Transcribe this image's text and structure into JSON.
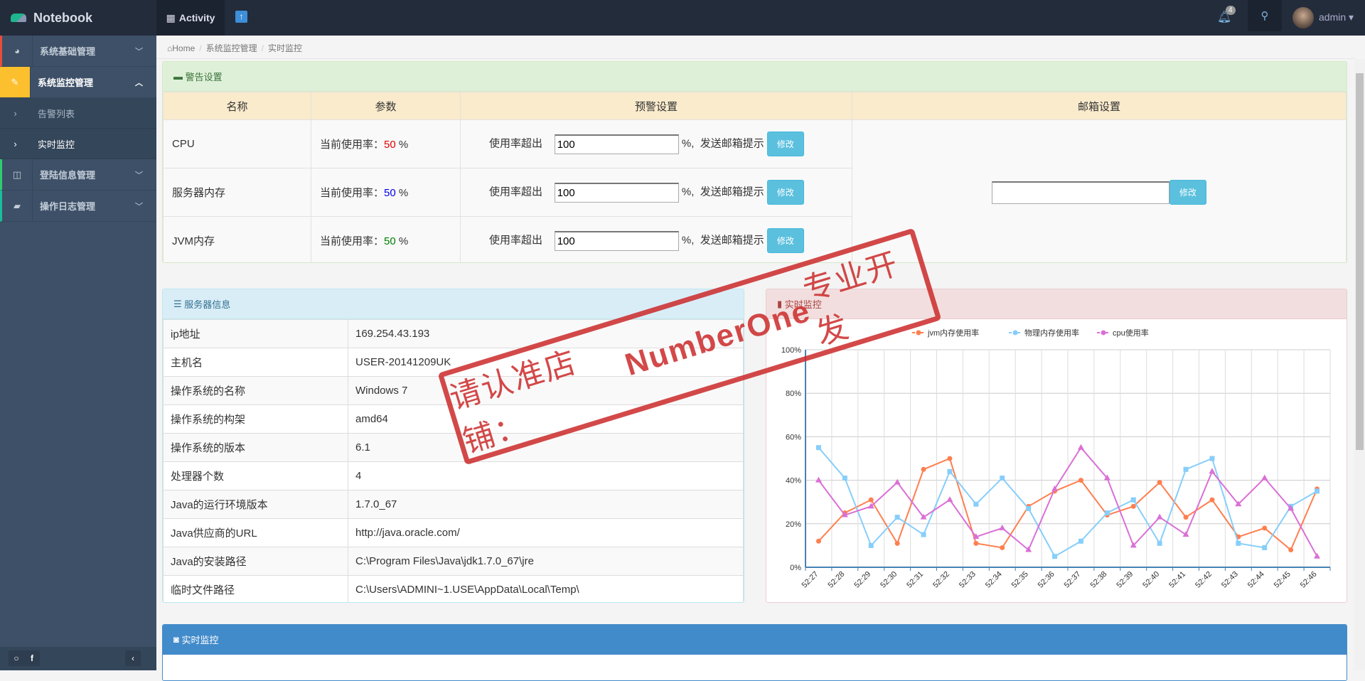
{
  "header": {
    "brand": "Notebook",
    "activity": "Activity",
    "notifications": "4",
    "user": "admin"
  },
  "sidebar": {
    "items": [
      {
        "label": "系统基础管理",
        "icon": "dashboard-icon"
      },
      {
        "label": "系统监控管理",
        "icon": "edit-icon",
        "sub": [
          {
            "label": "告警列表"
          },
          {
            "label": "实时监控"
          }
        ]
      },
      {
        "label": "登陆信息管理",
        "icon": "columns-icon"
      },
      {
        "label": "操作日志管理",
        "icon": "book-icon"
      }
    ]
  },
  "breadcrumb": [
    "Home",
    "系统监控管理",
    "实时监控"
  ],
  "alert": {
    "title": "警告设置",
    "headers": [
      "名称",
      "参数",
      "预警设置",
      "邮箱设置"
    ],
    "rows": [
      {
        "name": "CPU",
        "param_label": "当前使用率：",
        "value": "50",
        "unit": "%",
        "color": "#e00000",
        "threshold_label": "使用率超出",
        "threshold": "100",
        "suffix": "%,  发送邮箱提示",
        "btn": "修改"
      },
      {
        "name": "服务器内存",
        "param_label": "当前使用率：",
        "value": "50",
        "unit": "%",
        "color": "#0000ee",
        "threshold_label": "使用率超出",
        "threshold": "100",
        "suffix": "%,  发送邮箱提示",
        "btn": "修改"
      },
      {
        "name": "JVM内存",
        "param_label": "当前使用率：",
        "value": "50",
        "unit": "%",
        "color": "#008000",
        "threshold_label": "使用率超出",
        "threshold": "100",
        "suffix": "%,  发送邮箱提示",
        "btn": "修改"
      }
    ],
    "email": {
      "value": "",
      "btn": "修改"
    }
  },
  "server": {
    "title": "服务器信息",
    "rows": [
      [
        "ip地址",
        "169.254.43.193"
      ],
      [
        "主机名",
        "USER-20141209UK"
      ],
      [
        "操作系统的名称",
        "Windows 7"
      ],
      [
        "操作系统的构架",
        "amd64"
      ],
      [
        "操作系统的版本",
        "6.1"
      ],
      [
        "处理器个数",
        "4"
      ],
      [
        "Java的运行环境版本",
        "1.7.0_67"
      ],
      [
        "Java供应商的URL",
        "http://java.oracle.com/"
      ],
      [
        "Java的安装路径",
        "C:\\Program Files\\Java\\jdk1.7.0_67\\jre"
      ],
      [
        "临时文件路径",
        "C:\\Users\\ADMINI~1.USE\\AppData\\Local\\Temp\\"
      ]
    ]
  },
  "monitor": {
    "title": "实时监控"
  },
  "bottom": {
    "title": "实时监控"
  },
  "stamp": "请认准店铺：NumberOne专业开发",
  "chart_data": {
    "type": "line",
    "title": "",
    "xlabel": "",
    "ylabel": "",
    "ylim": [
      0,
      100
    ],
    "yticks": [
      "0%",
      "20%",
      "40%",
      "60%",
      "80%",
      "100%"
    ],
    "categories": [
      "52:27",
      "52:28",
      "52:29",
      "52:30",
      "52:31",
      "52:32",
      "52:33",
      "52:34",
      "52:35",
      "52:36",
      "52:37",
      "52:38",
      "52:39",
      "52:40",
      "52:41",
      "52:42",
      "52:43",
      "52:44",
      "52:45",
      "52:46"
    ],
    "legend_position": "top-center",
    "series": [
      {
        "name": "jvm内存使用率",
        "color": "#ff7f50",
        "marker": "circle",
        "values": [
          12,
          25,
          31,
          11,
          45,
          50,
          11,
          9,
          28,
          35,
          40,
          24,
          28,
          39,
          23,
          31,
          14,
          18,
          8,
          36
        ]
      },
      {
        "name": "物理内存使用率",
        "color": "#87cefa",
        "marker": "square",
        "values": [
          55,
          41,
          10,
          23,
          15,
          44,
          29,
          41,
          27,
          5,
          12,
          25,
          31,
          11,
          45,
          50,
          11,
          9,
          28,
          35
        ]
      },
      {
        "name": "cpu使用率",
        "color": "#da70d6",
        "marker": "triangle",
        "values": [
          40,
          24,
          28,
          39,
          23,
          31,
          14,
          18,
          8,
          36,
          55,
          41,
          10,
          23,
          15,
          44,
          29,
          41,
          27,
          5
        ]
      }
    ]
  }
}
